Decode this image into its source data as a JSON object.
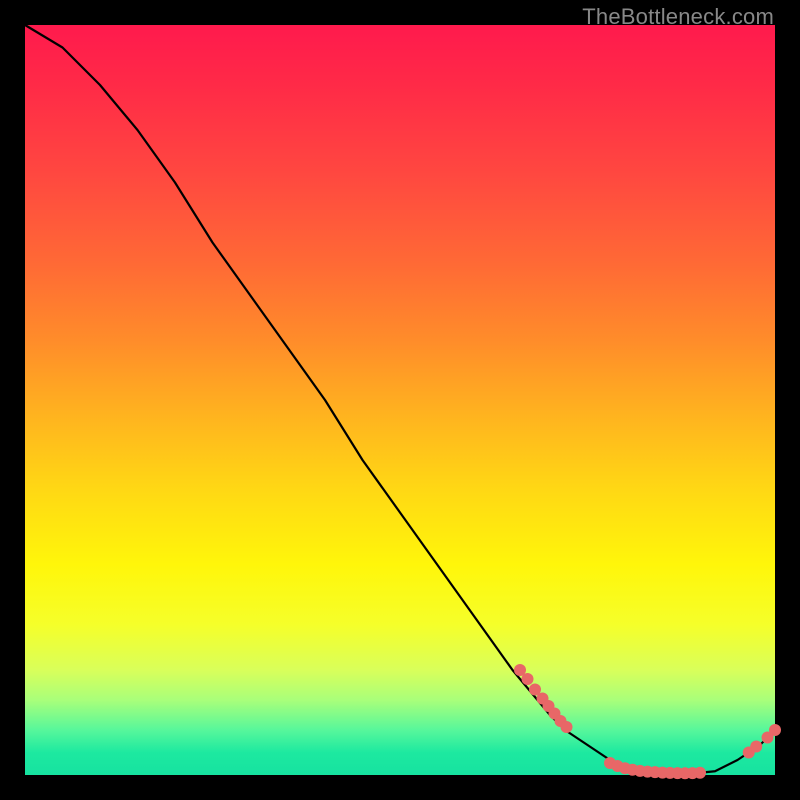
{
  "watermark": "TheBottleneck.com",
  "chart_data": {
    "type": "line",
    "title": "",
    "xlabel": "",
    "ylabel": "",
    "xlim": [
      0,
      100
    ],
    "ylim": [
      0,
      100
    ],
    "grid": false,
    "background_gradient": [
      "#ff1a4d",
      "#ff6a35",
      "#ffd814",
      "#57f79b",
      "#16e2a0"
    ],
    "series": [
      {
        "name": "curve",
        "color": "#000000",
        "x": [
          0,
          5,
          10,
          15,
          20,
          25,
          30,
          35,
          40,
          45,
          50,
          55,
          60,
          65,
          70,
          72,
          75,
          78,
          80,
          83,
          85,
          88,
          90,
          92,
          95,
          98,
          100
        ],
        "y": [
          100,
          97,
          92,
          86,
          79,
          71,
          64,
          57,
          50,
          42,
          35,
          28,
          21,
          14,
          8,
          6,
          4,
          2,
          1,
          0.5,
          0.3,
          0.2,
          0.3,
          0.5,
          2,
          4,
          6
        ]
      }
    ],
    "markers": [
      {
        "name": "cluster-left-1",
        "color": "#e86767",
        "x": 66.0,
        "y": 14.0
      },
      {
        "name": "cluster-left-2",
        "color": "#e86767",
        "x": 67.0,
        "y": 12.8
      },
      {
        "name": "cluster-left-3",
        "color": "#e86767",
        "x": 68.0,
        "y": 11.4
      },
      {
        "name": "cluster-left-4",
        "color": "#e86767",
        "x": 69.0,
        "y": 10.2
      },
      {
        "name": "cluster-left-5",
        "color": "#e86767",
        "x": 69.8,
        "y": 9.2
      },
      {
        "name": "cluster-left-6",
        "color": "#e86767",
        "x": 70.6,
        "y": 8.2
      },
      {
        "name": "cluster-left-7",
        "color": "#e86767",
        "x": 71.4,
        "y": 7.2
      },
      {
        "name": "cluster-left-8",
        "color": "#e86767",
        "x": 72.2,
        "y": 6.4
      },
      {
        "name": "clump-valley-1",
        "color": "#e86767",
        "x": 78.0,
        "y": 1.6
      },
      {
        "name": "clump-valley-2",
        "color": "#e86767",
        "x": 79.0,
        "y": 1.2
      },
      {
        "name": "clump-valley-3",
        "color": "#e86767",
        "x": 80.0,
        "y": 0.9
      },
      {
        "name": "clump-valley-4",
        "color": "#e86767",
        "x": 81.0,
        "y": 0.7
      },
      {
        "name": "clump-valley-5",
        "color": "#e86767",
        "x": 82.0,
        "y": 0.55
      },
      {
        "name": "clump-valley-6",
        "color": "#e86767",
        "x": 83.0,
        "y": 0.45
      },
      {
        "name": "clump-valley-7",
        "color": "#e86767",
        "x": 84.0,
        "y": 0.38
      },
      {
        "name": "clump-valley-8",
        "color": "#e86767",
        "x": 85.0,
        "y": 0.32
      },
      {
        "name": "clump-valley-9",
        "color": "#e86767",
        "x": 86.0,
        "y": 0.28
      },
      {
        "name": "clump-valley-10",
        "color": "#e86767",
        "x": 87.0,
        "y": 0.25
      },
      {
        "name": "clump-valley-11",
        "color": "#e86767",
        "x": 88.0,
        "y": 0.24
      },
      {
        "name": "clump-valley-12",
        "color": "#e86767",
        "x": 89.0,
        "y": 0.25
      },
      {
        "name": "clump-valley-13",
        "color": "#e86767",
        "x": 90.0,
        "y": 0.3
      },
      {
        "name": "right-up-1",
        "color": "#e86767",
        "x": 96.5,
        "y": 3.0
      },
      {
        "name": "right-up-2",
        "color": "#e86767",
        "x": 97.5,
        "y": 3.8
      },
      {
        "name": "right-up-3",
        "color": "#e86767",
        "x": 99.0,
        "y": 5.0
      },
      {
        "name": "right-up-4",
        "color": "#e86767",
        "x": 100.0,
        "y": 6.0
      }
    ]
  }
}
